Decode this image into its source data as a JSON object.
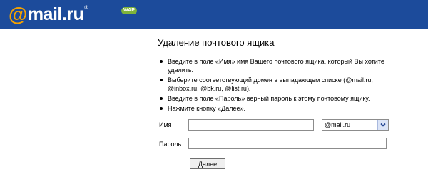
{
  "header": {
    "logo_at": "@",
    "logo_text": "mail.ru",
    "logo_reg": "®",
    "badge": "WAP"
  },
  "title": "Удаление почтового ящика",
  "instructions": [
    "Введите в поле «Имя» имя Вашего почтового ящика, который Вы хотите удалить.",
    "Выберите соответствующий домен в выпадающем списке (@mail.ru, @inbox.ru, @bk.ru, @list.ru).",
    "Введите в поле «Пароль» верный пароль к этому почтовому ящику.",
    "Нажмите кнопку «Далее»."
  ],
  "form": {
    "name_label": "Имя",
    "name_value": "",
    "domain_selected": "@mail.ru",
    "password_label": "Пароль",
    "password_value": "",
    "submit_label": "Далее"
  },
  "colors": {
    "header_bg": "#1c4b9b",
    "logo_at": "#f5a200",
    "badge_bg": "#7fb33a"
  },
  "icons": {
    "dropdown_arrow": "chevron-down-icon",
    "bullet": "bullet-icon"
  }
}
